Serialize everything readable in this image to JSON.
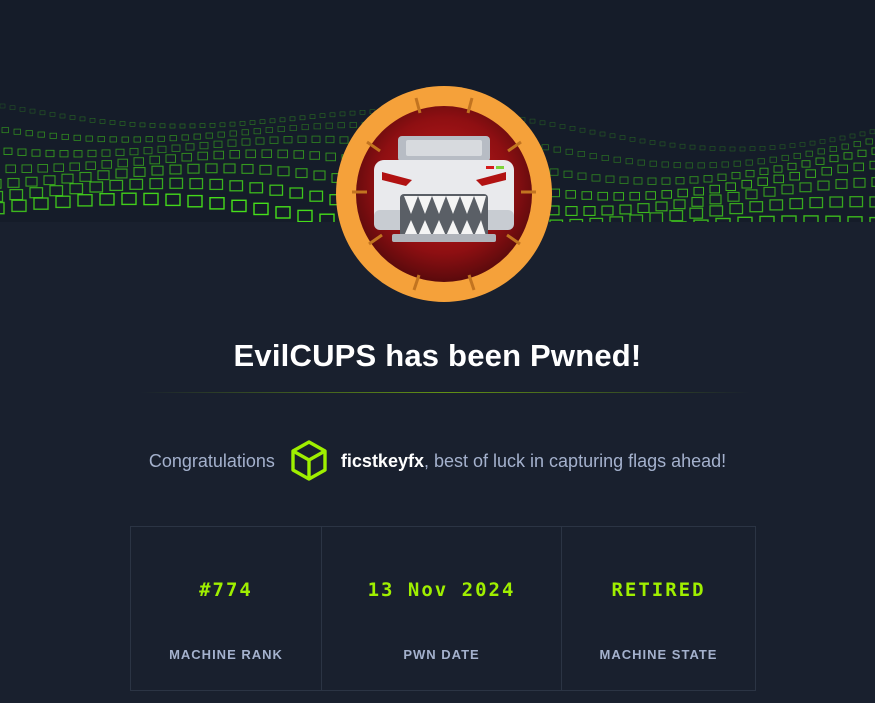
{
  "heading": "EvilCUPS has been Pwned!",
  "congrats": {
    "prefix": "Congratulations",
    "username": "ficstkeyfx",
    "suffix": ", best of luck in capturing flags ahead!"
  },
  "stats": [
    {
      "value": "#774",
      "label": "MACHINE RANK"
    },
    {
      "value": "13 Nov 2024",
      "label": "PWN DATE"
    },
    {
      "value": "RETIRED",
      "label": "MACHINE STATE"
    }
  ],
  "colors": {
    "background": "#19202e",
    "accent": "#9fef00",
    "badge_ring": "#f5a13a",
    "muted_text": "#a4b1cd"
  },
  "icons": {
    "badge": "evilcups-printer-badge",
    "user": "cube-icon"
  }
}
